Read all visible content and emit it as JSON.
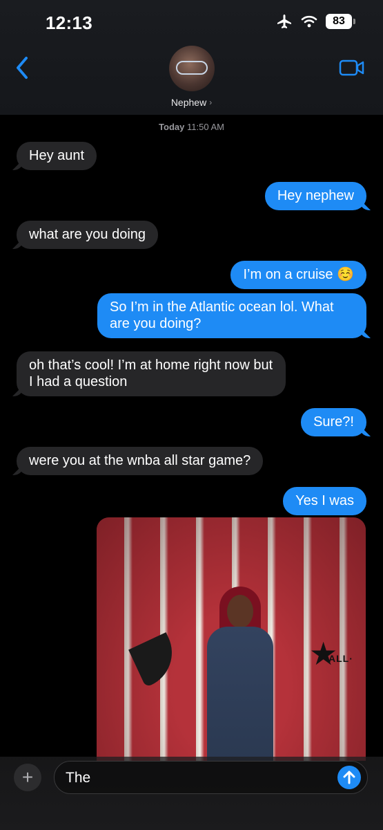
{
  "status_bar": {
    "time": "12:13",
    "battery": "83",
    "icons": [
      "airplane-icon",
      "wifi-icon",
      "battery-icon"
    ]
  },
  "header": {
    "contact_name": "Nephew",
    "back_icon": "chevron-left-icon",
    "video_icon": "video-camera-icon",
    "accent_color": "#1e8bf5"
  },
  "conversation": {
    "timestamp_day": "Today",
    "timestamp_time": "11:50 AM",
    "messages": [
      {
        "from": "contact",
        "text": "Hey aunt"
      },
      {
        "from": "me",
        "text": "Hey nephew"
      },
      {
        "from": "contact",
        "text": "what are you doing"
      },
      {
        "from": "me",
        "text": "I’m on a cruise ☺️"
      },
      {
        "from": "me",
        "text": "So I’m in the Atlantic ocean lol. What are you doing?"
      },
      {
        "from": "contact",
        "text": "oh that’s cool! I’m at home right now but I had a question"
      },
      {
        "from": "me",
        "text": "Sure?!"
      },
      {
        "from": "contact",
        "text": "were you at the wnba all star game?"
      },
      {
        "from": "me",
        "text": "Yes I was"
      }
    ],
    "photo": {
      "from": "me",
      "logo_text": "ALL·"
    }
  },
  "composer": {
    "text": "The",
    "plus_icon": "plus-icon",
    "send_icon": "arrow-up-icon"
  }
}
